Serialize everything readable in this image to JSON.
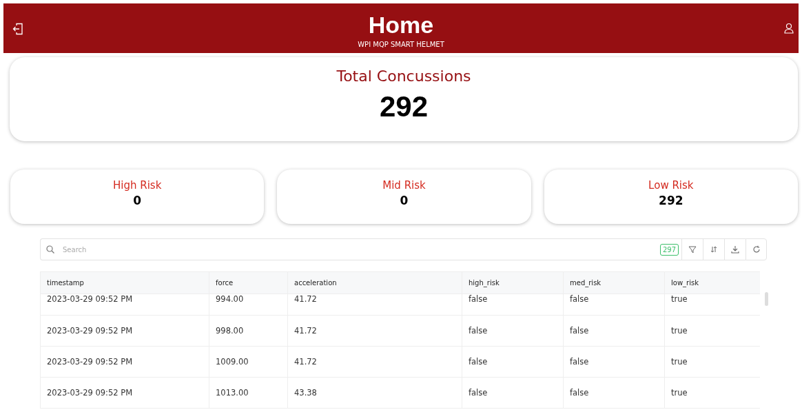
{
  "header": {
    "title": "Home",
    "subtitle": "WPI MQP SMART HELMET"
  },
  "total": {
    "label": "Total Concussions",
    "value": "292"
  },
  "risk_cards": [
    {
      "label": "High Risk",
      "value": "0"
    },
    {
      "label": "Mid Risk",
      "value": "0"
    },
    {
      "label": "Low Risk",
      "value": "292"
    }
  ],
  "toolbar": {
    "search_placeholder": "Search",
    "count": "297"
  },
  "table": {
    "columns": [
      "timestamp",
      "force",
      "acceleration",
      "high_risk",
      "med_risk",
      "low_risk"
    ],
    "rows": [
      [
        "2023-03-29 09:52 PM",
        "994.00",
        "41.72",
        "false",
        "false",
        "true"
      ],
      [
        "2023-03-29 09:52 PM",
        "998.00",
        "41.72",
        "false",
        "false",
        "true"
      ],
      [
        "2023-03-29 09:52 PM",
        "1009.00",
        "41.72",
        "false",
        "false",
        "true"
      ],
      [
        "2023-03-29 09:52 PM",
        "1013.00",
        "43.38",
        "false",
        "false",
        "true"
      ]
    ]
  }
}
